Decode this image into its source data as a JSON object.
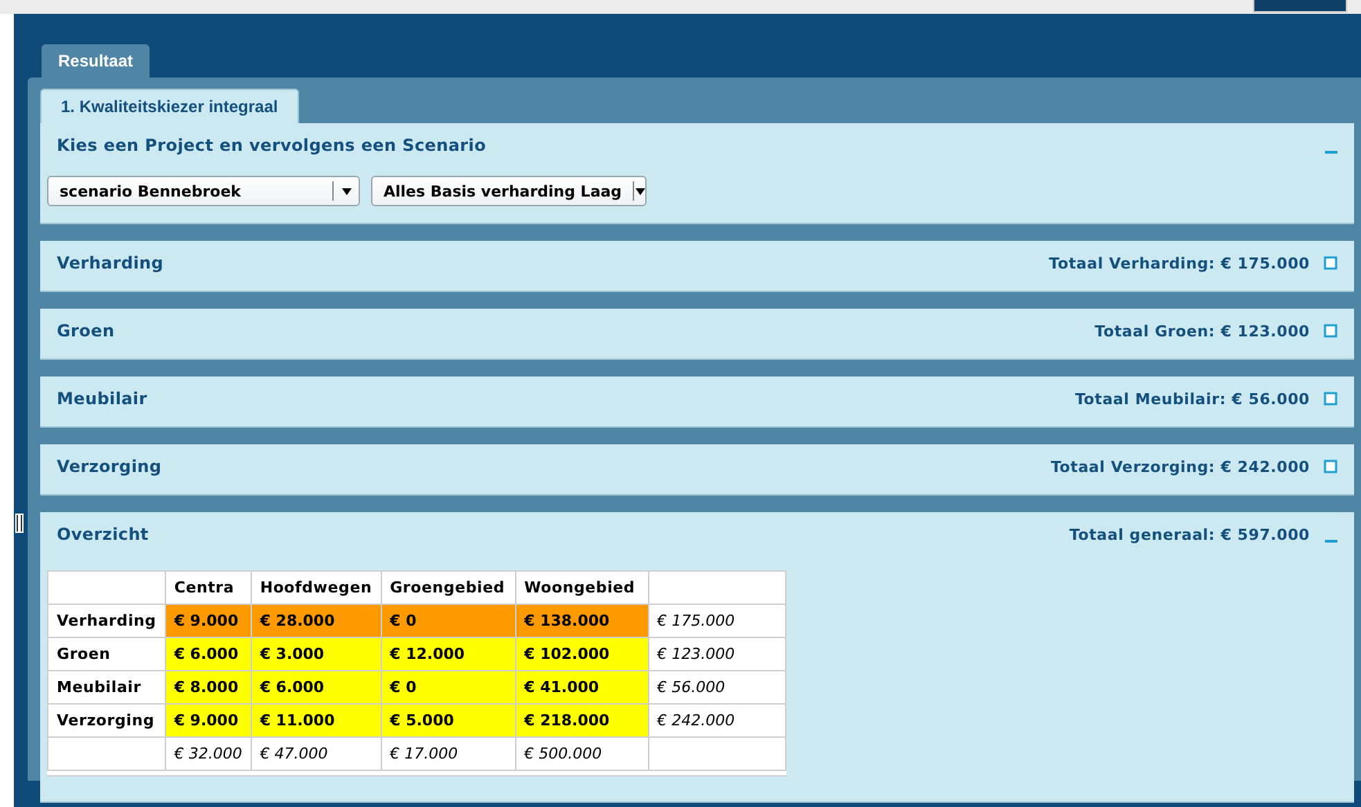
{
  "outer_tabs": [
    {
      "label": "Resultaat",
      "selected": true
    }
  ],
  "inner_tabs": [
    {
      "label": "1. Kwaliteitskiezer integraal",
      "selected": true
    }
  ],
  "sections": [
    {
      "kind": "selector",
      "title": "Kies een Project en vervolgens een Scenario",
      "expanded": true,
      "selects": [
        {
          "value": "scenario Bennebroek"
        },
        {
          "value": "Alles Basis verharding Laag"
        }
      ]
    },
    {
      "kind": "summary",
      "title": "Verharding",
      "total": "Totaal Verharding: € 175.000",
      "expanded": false
    },
    {
      "kind": "summary",
      "title": "Groen",
      "total": "Totaal Groen: € 123.000",
      "expanded": false
    },
    {
      "kind": "summary",
      "title": "Meubilair",
      "total": "Totaal Meubilair: € 56.000",
      "expanded": false
    },
    {
      "kind": "summary",
      "title": "Verzorging",
      "total": "Totaal Verzorging: € 242.000",
      "expanded": false
    },
    {
      "kind": "overview",
      "title": "Overzicht",
      "total": "Totaal generaal: € 597.000",
      "expanded": true,
      "table": {
        "columns": [
          "Centra",
          "Hoofdwegen",
          "Groengebied",
          "Woongebied"
        ],
        "rows": [
          {
            "label": "Verharding",
            "cells": [
              {
                "text": "€ 9.000",
                "color": "#ff9900"
              },
              {
                "text": "€ 28.000",
                "color": "#ff9900"
              },
              {
                "text": "€ 0",
                "color": "#ff9900"
              },
              {
                "text": "€ 138.000",
                "color": "#ff9900"
              }
            ],
            "total": "€ 175.000"
          },
          {
            "label": "Groen",
            "cells": [
              {
                "text": "€ 6.000",
                "color": "#ffff00"
              },
              {
                "text": "€ 3.000",
                "color": "#ffff00"
              },
              {
                "text": "€ 12.000",
                "color": "#ffff00"
              },
              {
                "text": "€ 102.000",
                "color": "#ffff00"
              }
            ],
            "total": "€ 123.000"
          },
          {
            "label": "Meubilair",
            "cells": [
              {
                "text": "€ 8.000",
                "color": "#ffff00"
              },
              {
                "text": "€ 6.000",
                "color": "#ffff00"
              },
              {
                "text": "€ 0",
                "color": "#ffff00"
              },
              {
                "text": "€ 41.000",
                "color": "#ffff00"
              }
            ],
            "total": "€ 56.000"
          },
          {
            "label": "Verzorging",
            "cells": [
              {
                "text": "€ 9.000",
                "color": "#ffff00"
              },
              {
                "text": "€ 11.000",
                "color": "#ffff00"
              },
              {
                "text": "€ 5.000",
                "color": "#ffff00"
              },
              {
                "text": "€ 218.000",
                "color": "#ffff00"
              }
            ],
            "total": "€ 242.000"
          }
        ],
        "column_totals": [
          "€ 32.000",
          "€ 47.000",
          "€ 17.000",
          "€ 500.000"
        ]
      }
    }
  ]
}
